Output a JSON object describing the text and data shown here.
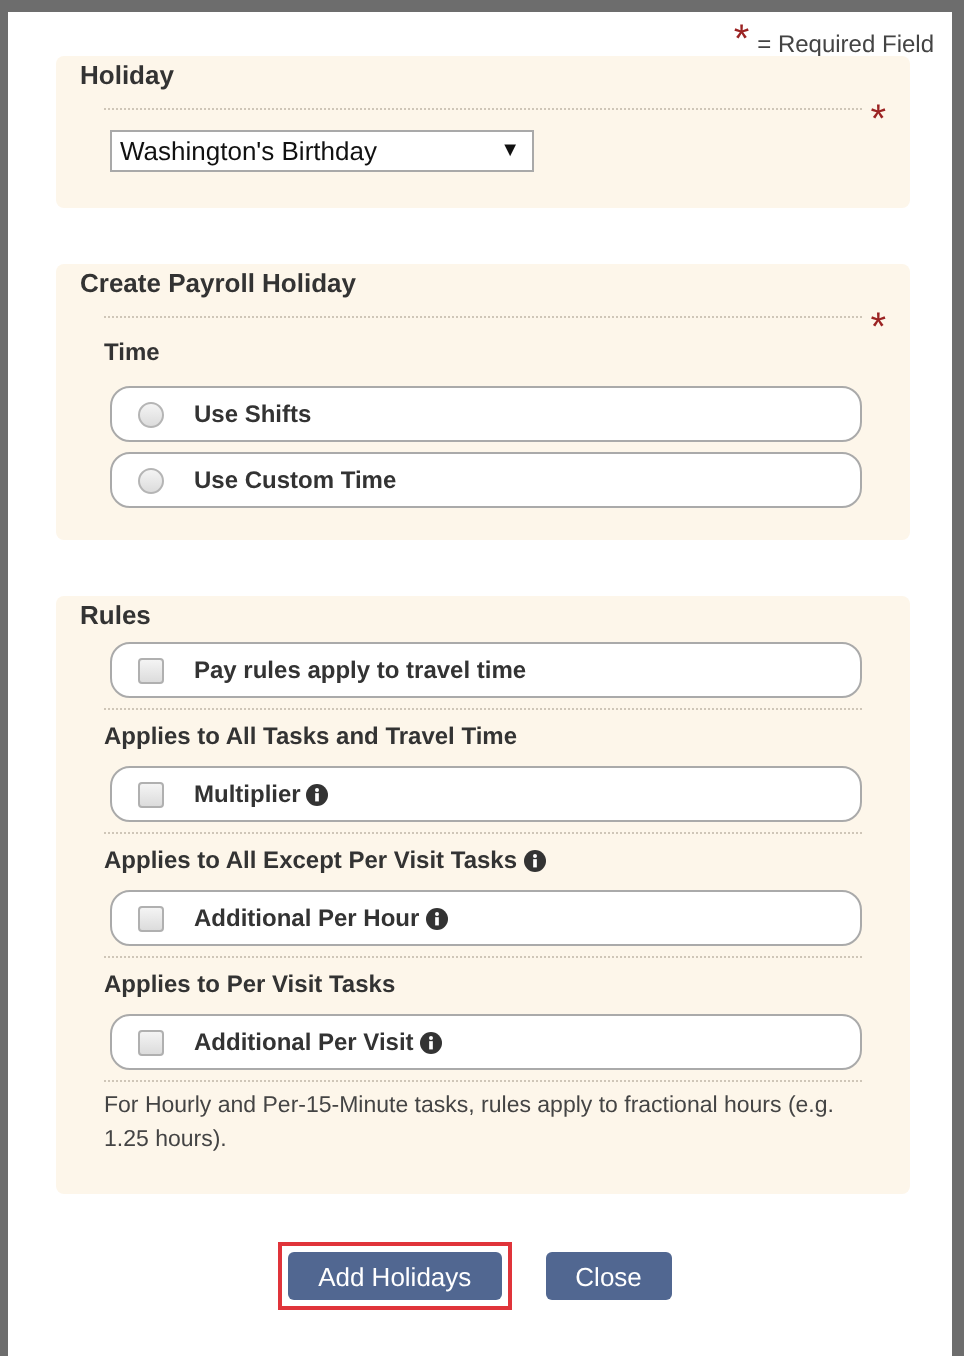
{
  "legend": {
    "mark": "*",
    "text": "= Required Field"
  },
  "holiday": {
    "title": "Holiday",
    "required": true,
    "select": {
      "value": "Washington's Birthday",
      "arrow": "▼"
    }
  },
  "payroll": {
    "title": "Create Payroll Holiday",
    "time": {
      "label": "Time",
      "required": true,
      "options": [
        {
          "label": "Use Shifts",
          "selected": false
        },
        {
          "label": "Use Custom Time",
          "selected": false
        }
      ]
    }
  },
  "rules": {
    "title": "Rules",
    "items": [
      {
        "kind": "option",
        "label": "Pay rules apply to travel time",
        "checked": false,
        "info": false
      },
      {
        "kind": "heading",
        "label": "Applies to All Tasks and Travel Time",
        "info": false
      },
      {
        "kind": "option",
        "label": "Multiplier",
        "checked": false,
        "info": true
      },
      {
        "kind": "heading",
        "label": "Applies to All Except Per Visit Tasks",
        "info": true
      },
      {
        "kind": "option",
        "label": "Additional Per Hour",
        "checked": false,
        "info": true
      },
      {
        "kind": "heading",
        "label": "Applies to Per Visit Tasks",
        "info": false
      },
      {
        "kind": "option",
        "label": "Additional Per Visit",
        "checked": false,
        "info": true
      },
      {
        "kind": "note",
        "label": "For Hourly and Per-15-Minute tasks, rules apply to fractional hours (e.g. 1.25 hours)."
      }
    ]
  },
  "buttons": [
    {
      "label": "Add Holidays",
      "highlighted": true
    },
    {
      "label": "Close",
      "highlighted": false
    }
  ]
}
